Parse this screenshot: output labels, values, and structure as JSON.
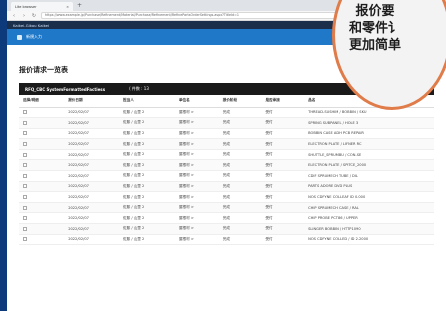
{
  "browser": {
    "tab_title": "Lite browser",
    "tab_close": "×",
    "new_tab": "+",
    "url": "https://www.example.jp/Purchase/Refinement/Material/Purchase/Refinement/RefinePartsOrderSettings.aspx?TitleId=1"
  },
  "app": {
    "header": "Kaikei-Gikou Kaikei",
    "menu_label": "新規入力"
  },
  "page": {
    "title": "报价请求一览表"
  },
  "bar": {
    "left": "RFQ_CBC SystemFormattedFactiess",
    "right": "( 件数 : 13"
  },
  "table": {
    "headers": [
      "选择/明细",
      "报价日期",
      "担当人",
      "单位名",
      "报价阶段",
      "是否承接",
      "品名"
    ],
    "rows": [
      [
        "",
        "2022/02/07",
        "佐藤 / 山里 2",
        "屋根材 >",
        "完成",
        "受付",
        "THREAD-SUSHIM / BOBBIN / SKU"
      ],
      [
        "",
        "2022/02/07",
        "佐藤 / 山里 2",
        "屋根材 >",
        "完成",
        "受付",
        "SPRING SUBPANEL / HOLE 3"
      ],
      [
        "",
        "2022/02/07",
        "佐藤 / 山里 2",
        "屋根材 >",
        "完成",
        "受付",
        "BOBBIN CASE ADH PCB REPAIR"
      ],
      [
        "",
        "2022/02/07",
        "佐藤 / 山里 2",
        "屋根材 >",
        "完成",
        "受付",
        "ELECTRON PLATE / LIFNER RC"
      ],
      [
        "",
        "2022/02/07",
        "佐藤 / 山里 2",
        "屋根材 >",
        "完成",
        "受付",
        "SHUTTLE_SPRUMBU / CON-SE"
      ],
      [
        "",
        "2022/02/07",
        "佐藤 / 山里 2",
        "屋根材 >",
        "完成",
        "受付",
        "ELECTRON PLATE / SPITCE_2000"
      ],
      [
        "",
        "2022/02/07",
        "佐藤 / 山里 2",
        "屋根材 >",
        "完成",
        "受付",
        "CDIF SPRUMECH TUBE / DIL"
      ],
      [
        "",
        "2022/02/07",
        "佐藤 / 山里 2",
        "屋根材 >",
        "完成",
        "受付",
        "PARTS ADORE DVD PLUS"
      ],
      [
        "",
        "2022/02/07",
        "佐藤 / 山里 2",
        "屋根材 >",
        "完成",
        "受付",
        "NOS CDFYNE COLLEAF ID 0.000"
      ],
      [
        "",
        "2022/02/07",
        "佐藤 / 山里 2",
        "屋根材 >",
        "完成",
        "受付",
        "CHIP SPRUMECH CASE / RAL"
      ],
      [
        "",
        "2022/02/07",
        "佐藤 / 山里 2",
        "屋根材 >",
        "完成",
        "受付",
        "CHIP PROBE PCT86 / UPPER"
      ],
      [
        "",
        "2022/02/07",
        "佐藤 / 山里 2",
        "屋根材 >",
        "完成",
        "受付",
        "SLINGER BOBBIN / HTTP1090"
      ],
      [
        "",
        "2022/02/07",
        "佐藤 / 山里 2",
        "屋根材 >",
        "完成",
        "受付",
        "NOS CDFYNE COLLED / ID 2.2000"
      ]
    ]
  },
  "overlay": {
    "line1": "报价要",
    "line2": "和零件讠",
    "line3": "更加简单"
  },
  "colors": {
    "frame": "#0d3a7a",
    "blue_bar": "#1f78c8",
    "accent_ring": "#e07b4a"
  }
}
